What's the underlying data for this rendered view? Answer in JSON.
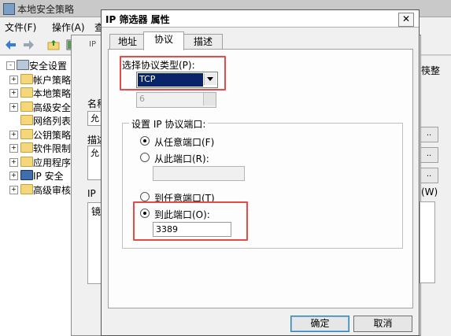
{
  "mmc": {
    "title": "本地安全策略",
    "menu": [
      "文件(F)",
      "操作(A)",
      "查"
    ],
    "tree": [
      {
        "label": "安全设置",
        "expand": "-"
      },
      {
        "label": "帐户策略",
        "expand": "+"
      },
      {
        "label": "本地策略",
        "expand": "+"
      },
      {
        "label": "高级安全",
        "expand": "+"
      },
      {
        "label": "网络列表",
        "expand": ""
      },
      {
        "label": "公钥策略",
        "expand": "+"
      },
      {
        "label": "软件限制",
        "expand": "+"
      },
      {
        "label": "应用程序",
        "expand": "+"
      },
      {
        "label": "IP 安全",
        "expand": "+"
      },
      {
        "label": "高级审核",
        "expand": "+"
      }
    ],
    "right_labels": {
      "top": "筷整",
      "w": "(W)"
    }
  },
  "mid": {
    "label_name": "名称",
    "name_value": "允",
    "label_desc": "描述",
    "desc_value": "允",
    "ip_label": "IP",
    "list_header": "镜",
    "toolbar_ip": "IP"
  },
  "dialog": {
    "title": "IP 筛选器 属性",
    "close": "✕",
    "tabs": [
      "地址",
      "协议",
      "描述"
    ],
    "active_tab": 1,
    "protocol_label": "选择协议类型(P):",
    "protocol_value": "TCP",
    "protocol_number": "6",
    "port_group_label": "设置 IP 协议端口:",
    "from_any": "从任意端口(F)",
    "from_this": "从此端口(R):",
    "from_this_value": "",
    "to_any": "到任意端口(T)",
    "to_this": "到此端口(O):",
    "to_this_value": "3389",
    "ok": "确定",
    "cancel": "取消"
  },
  "colors": {
    "highlight": "#e84a4a",
    "selection": "#0a246a"
  }
}
